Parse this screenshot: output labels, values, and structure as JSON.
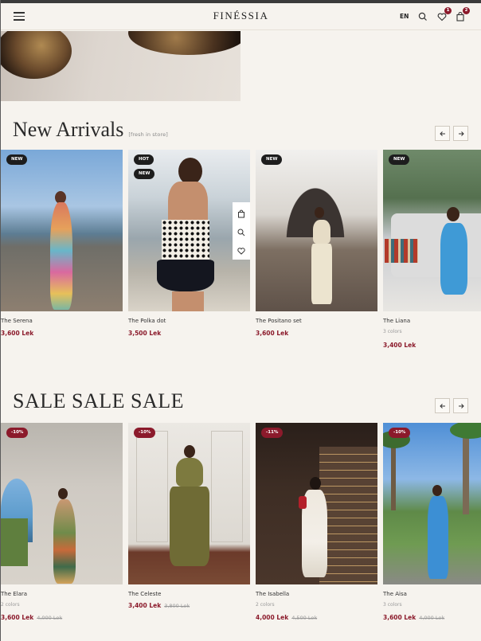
{
  "header": {
    "logo": "FINÉSSIA",
    "lang": "EN",
    "wishlist_count": "1",
    "cart_count": "2"
  },
  "new_arrivals": {
    "title": "New Arrivals",
    "subtitle": "[fresh in store]",
    "products": [
      {
        "name": "The Serena",
        "price": "3,600 Lek",
        "tags": [
          "NEW"
        ]
      },
      {
        "name": "The Polka dot",
        "price": "3,500 Lek",
        "tags": [
          "HOT",
          "NEW"
        ]
      },
      {
        "name": "The Positano set",
        "price": "3,600 Lek",
        "tags": [
          "NEW"
        ]
      },
      {
        "name": "The Liana",
        "colors": "3 colors",
        "price": "3,400 Lek",
        "tags": [
          "NEW"
        ]
      }
    ]
  },
  "sale": {
    "title": "SALE SALE SALE",
    "products": [
      {
        "name": "The Elara",
        "colors": "2 colors",
        "price": "3,600 Lek",
        "old_price": "4,000 Lek",
        "tag": "-10%"
      },
      {
        "name": "The Celeste",
        "price": "3,400 Lek",
        "old_price": "3,800 Lek",
        "tag": "-10%"
      },
      {
        "name": "The Isabella",
        "colors": "2 colors",
        "price": "4,000 Lek",
        "old_price": "4,500 Lek",
        "tag": "-11%"
      },
      {
        "name": "The Aisa",
        "colors": "3 colors",
        "price": "3,600 Lek",
        "old_price": "4,000 Lek",
        "tag": "-10%"
      }
    ]
  },
  "colors": {
    "accent": "#8b1a2b",
    "background": "#f6f3ee",
    "tag_dark": "#1d1d1d"
  },
  "icons": [
    "menu-icon",
    "search-icon",
    "heart-icon",
    "bag-icon",
    "arrow-left-icon",
    "arrow-right-icon",
    "zoom-icon"
  ]
}
